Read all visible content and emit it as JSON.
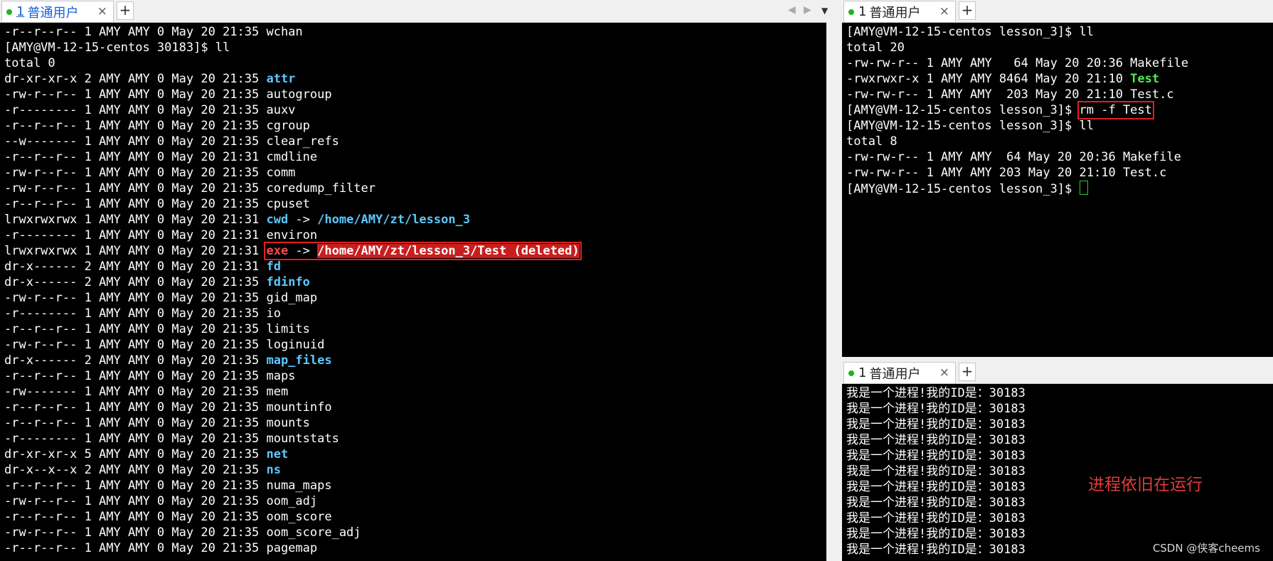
{
  "left_pane": {
    "tab": {
      "num": "1",
      "name": "普通用户",
      "close": "×"
    },
    "add_tab": "+",
    "nav_left": "◀",
    "nav_right": "▶",
    "nav_menu": "▼",
    "lines": [
      {
        "perm": "-r--r--r--",
        "links": "1",
        "user": "AMY",
        "group": "AMY",
        "size": "0",
        "date": "May 20 21:35",
        "name": "wchan",
        "type": "plain"
      },
      {
        "raw": "[AMY@VM-12-15-centos 30183]$ ll"
      },
      {
        "raw": "total 0"
      },
      {
        "perm": "dr-xr-xr-x",
        "links": "2",
        "user": "AMY",
        "group": "AMY",
        "size": "0",
        "date": "May 20 21:35",
        "name": "attr",
        "type": "dir"
      },
      {
        "perm": "-rw-r--r--",
        "links": "1",
        "user": "AMY",
        "group": "AMY",
        "size": "0",
        "date": "May 20 21:35",
        "name": "autogroup",
        "type": "plain"
      },
      {
        "perm": "-r--------",
        "links": "1",
        "user": "AMY",
        "group": "AMY",
        "size": "0",
        "date": "May 20 21:35",
        "name": "auxv",
        "type": "plain"
      },
      {
        "perm": "-r--r--r--",
        "links": "1",
        "user": "AMY",
        "group": "AMY",
        "size": "0",
        "date": "May 20 21:35",
        "name": "cgroup",
        "type": "plain"
      },
      {
        "perm": "--w-------",
        "links": "1",
        "user": "AMY",
        "group": "AMY",
        "size": "0",
        "date": "May 20 21:35",
        "name": "clear_refs",
        "type": "plain"
      },
      {
        "perm": "-r--r--r--",
        "links": "1",
        "user": "AMY",
        "group": "AMY",
        "size": "0",
        "date": "May 20 21:31",
        "name": "cmdline",
        "type": "plain"
      },
      {
        "perm": "-rw-r--r--",
        "links": "1",
        "user": "AMY",
        "group": "AMY",
        "size": "0",
        "date": "May 20 21:35",
        "name": "comm",
        "type": "plain"
      },
      {
        "perm": "-rw-r--r--",
        "links": "1",
        "user": "AMY",
        "group": "AMY",
        "size": "0",
        "date": "May 20 21:35",
        "name": "coredump_filter",
        "type": "plain"
      },
      {
        "perm": "-r--r--r--",
        "links": "1",
        "user": "AMY",
        "group": "AMY",
        "size": "0",
        "date": "May 20 21:35",
        "name": "cpuset",
        "type": "plain"
      },
      {
        "perm": "lrwxrwxrwx",
        "links": "1",
        "user": "AMY",
        "group": "AMY",
        "size": "0",
        "date": "May 20 21:31",
        "name": "cwd",
        "type": "link",
        "target": "/home/AMY/zt/lesson_3"
      },
      {
        "perm": "-r--------",
        "links": "1",
        "user": "AMY",
        "group": "AMY",
        "size": "0",
        "date": "May 20 21:31",
        "name": "environ",
        "type": "plain"
      },
      {
        "perm": "lrwxrwxrwx",
        "links": "1",
        "user": "AMY",
        "group": "AMY",
        "size": "0",
        "date": "May 20 21:31",
        "name": "exe",
        "type": "deleted",
        "target": "/home/AMY/zt/lesson_3/Test (deleted)"
      },
      {
        "perm": "dr-x------",
        "links": "2",
        "user": "AMY",
        "group": "AMY",
        "size": "0",
        "date": "May 20 21:31",
        "name": "fd",
        "type": "dir"
      },
      {
        "perm": "dr-x------",
        "links": "2",
        "user": "AMY",
        "group": "AMY",
        "size": "0",
        "date": "May 20 21:35",
        "name": "fdinfo",
        "type": "dir"
      },
      {
        "perm": "-rw-r--r--",
        "links": "1",
        "user": "AMY",
        "group": "AMY",
        "size": "0",
        "date": "May 20 21:35",
        "name": "gid_map",
        "type": "plain"
      },
      {
        "perm": "-r--------",
        "links": "1",
        "user": "AMY",
        "group": "AMY",
        "size": "0",
        "date": "May 20 21:35",
        "name": "io",
        "type": "plain"
      },
      {
        "perm": "-r--r--r--",
        "links": "1",
        "user": "AMY",
        "group": "AMY",
        "size": "0",
        "date": "May 20 21:35",
        "name": "limits",
        "type": "plain"
      },
      {
        "perm": "-rw-r--r--",
        "links": "1",
        "user": "AMY",
        "group": "AMY",
        "size": "0",
        "date": "May 20 21:35",
        "name": "loginuid",
        "type": "plain"
      },
      {
        "perm": "dr-x------",
        "links": "2",
        "user": "AMY",
        "group": "AMY",
        "size": "0",
        "date": "May 20 21:35",
        "name": "map_files",
        "type": "dir"
      },
      {
        "perm": "-r--r--r--",
        "links": "1",
        "user": "AMY",
        "group": "AMY",
        "size": "0",
        "date": "May 20 21:35",
        "name": "maps",
        "type": "plain"
      },
      {
        "perm": "-rw-------",
        "links": "1",
        "user": "AMY",
        "group": "AMY",
        "size": "0",
        "date": "May 20 21:35",
        "name": "mem",
        "type": "plain"
      },
      {
        "perm": "-r--r--r--",
        "links": "1",
        "user": "AMY",
        "group": "AMY",
        "size": "0",
        "date": "May 20 21:35",
        "name": "mountinfo",
        "type": "plain"
      },
      {
        "perm": "-r--r--r--",
        "links": "1",
        "user": "AMY",
        "group": "AMY",
        "size": "0",
        "date": "May 20 21:35",
        "name": "mounts",
        "type": "plain"
      },
      {
        "perm": "-r--------",
        "links": "1",
        "user": "AMY",
        "group": "AMY",
        "size": "0",
        "date": "May 20 21:35",
        "name": "mountstats",
        "type": "plain"
      },
      {
        "perm": "dr-xr-xr-x",
        "links": "5",
        "user": "AMY",
        "group": "AMY",
        "size": "0",
        "date": "May 20 21:35",
        "name": "net",
        "type": "dir"
      },
      {
        "perm": "dr-x--x--x",
        "links": "2",
        "user": "AMY",
        "group": "AMY",
        "size": "0",
        "date": "May 20 21:35",
        "name": "ns",
        "type": "dir"
      },
      {
        "perm": "-r--r--r--",
        "links": "1",
        "user": "AMY",
        "group": "AMY",
        "size": "0",
        "date": "May 20 21:35",
        "name": "numa_maps",
        "type": "plain"
      },
      {
        "perm": "-rw-r--r--",
        "links": "1",
        "user": "AMY",
        "group": "AMY",
        "size": "0",
        "date": "May 20 21:35",
        "name": "oom_adj",
        "type": "plain"
      },
      {
        "perm": "-r--r--r--",
        "links": "1",
        "user": "AMY",
        "group": "AMY",
        "size": "0",
        "date": "May 20 21:35",
        "name": "oom_score",
        "type": "plain"
      },
      {
        "perm": "-rw-r--r--",
        "links": "1",
        "user": "AMY",
        "group": "AMY",
        "size": "0",
        "date": "May 20 21:35",
        "name": "oom_score_adj",
        "type": "plain"
      },
      {
        "perm": "-r--r--r--",
        "links": "1",
        "user": "AMY",
        "group": "AMY",
        "size": "0",
        "date": "May 20 21:35",
        "name": "pagemap",
        "type": "plain"
      }
    ]
  },
  "top_right_pane": {
    "tab": {
      "num": "1",
      "name": "普通用户",
      "close": "×"
    },
    "add_tab": "+",
    "lines": [
      {
        "kind": "prompt",
        "prompt": "[AMY@VM-12-15-centos lesson_3]$",
        "cmd": "ll"
      },
      {
        "kind": "raw",
        "text": "total 20"
      },
      {
        "kind": "file",
        "text": "-rw-rw-r-- 1 AMY AMY   64 May 20 20:36 ",
        "name": "Makefile",
        "type": "plain"
      },
      {
        "kind": "file",
        "text": "-rwxrwxr-x 1 AMY AMY 8464 May 20 21:10 ",
        "name": "Test",
        "type": "exec"
      },
      {
        "kind": "file",
        "text": "-rw-rw-r-- 1 AMY AMY  203 May 20 21:10 ",
        "name": "Test.c",
        "type": "plain"
      },
      {
        "kind": "prompt-box",
        "prompt": "[AMY@VM-12-15-centos lesson_3]$",
        "cmd": "rm -f Test"
      },
      {
        "kind": "prompt",
        "prompt": "[AMY@VM-12-15-centos lesson_3]$",
        "cmd": "ll"
      },
      {
        "kind": "raw",
        "text": "total 8"
      },
      {
        "kind": "file",
        "text": "-rw-rw-r-- 1 AMY AMY  64 May 20 20:36 ",
        "name": "Makefile",
        "type": "plain"
      },
      {
        "kind": "file",
        "text": "-rw-rw-r-- 1 AMY AMY 203 May 20 21:10 ",
        "name": "Test.c",
        "type": "plain"
      },
      {
        "kind": "cursor",
        "prompt": "[AMY@VM-12-15-centos lesson_3]$"
      }
    ]
  },
  "bottom_right_pane": {
    "tab": {
      "num": "1",
      "name": "普通用户",
      "close": "×"
    },
    "add_tab": "+",
    "output_line": "我是一个进程!我的ID是：30183",
    "output_repeat": 11
  },
  "annotation": "进程依旧在运行",
  "watermark": "CSDN @侠客cheems",
  "colors": {
    "dir": "#5cc8ff",
    "exec": "#4eec4e",
    "deleted": "#ff4a4a",
    "box": "#e02020",
    "tab_active": "#1a5fd6"
  }
}
